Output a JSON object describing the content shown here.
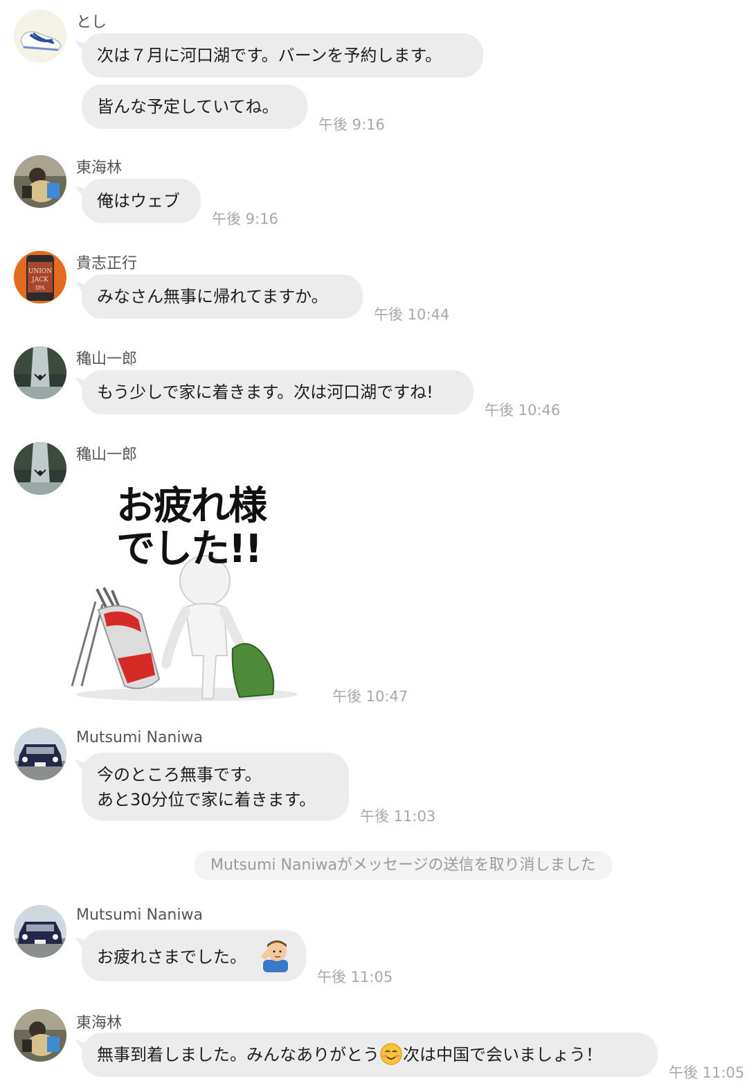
{
  "messages": [
    {
      "sender": "とし",
      "bubbles": [
        "次は７月に河口湖です。バーンを予約します。",
        "皆んな予定していてね。"
      ],
      "time": "午後 9:16"
    },
    {
      "sender": "東海林",
      "bubbles": [
        "俺はウェブ"
      ],
      "time": "午後 9:16"
    },
    {
      "sender": "貴志正行",
      "bubbles": [
        "みなさん無事に帰れてますか。"
      ],
      "time": "午後 10:44"
    },
    {
      "sender": "穐山一郎",
      "bubbles": [
        "もう少しで家に着きます。次は河口湖ですね!"
      ],
      "time": "午後 10:46"
    },
    {
      "sender": "穐山一郎",
      "sticker_text": "お疲れ様\nでした!!",
      "time": "午後 10:47"
    },
    {
      "sender": "Mutsumi Naniwa",
      "bubbles": [
        "今のところ無事です。",
        "あと30分位で家に着きます。"
      ],
      "time": "午後 11:03"
    },
    {
      "sender": "Mutsumi Naniwa",
      "bubbles": [
        "お疲れさまでした。"
      ],
      "time": "午後 11:05"
    },
    {
      "sender": "東海林",
      "bubbles": [
        "無事到着しました。みんなありがとう",
        "次は中国で会いましょう！"
      ],
      "time": "午後 11:05"
    }
  ],
  "system_notice": "Mutsumi Naniwaがメッセージの送信を取り消しました",
  "icons": {
    "sneaker": "sneaker-avatar-icon",
    "child": "child-photo-avatar-icon",
    "beer": "beer-can-avatar-icon",
    "waterfall": "waterfall-avatar-icon",
    "car": "classic-car-avatar-icon",
    "salute": "salute-man-emoji-icon",
    "smile": "smile-emoji-icon"
  },
  "colors": {
    "bubble": "#ececec",
    "time": "#a8a8a8",
    "sender": "#555555"
  }
}
